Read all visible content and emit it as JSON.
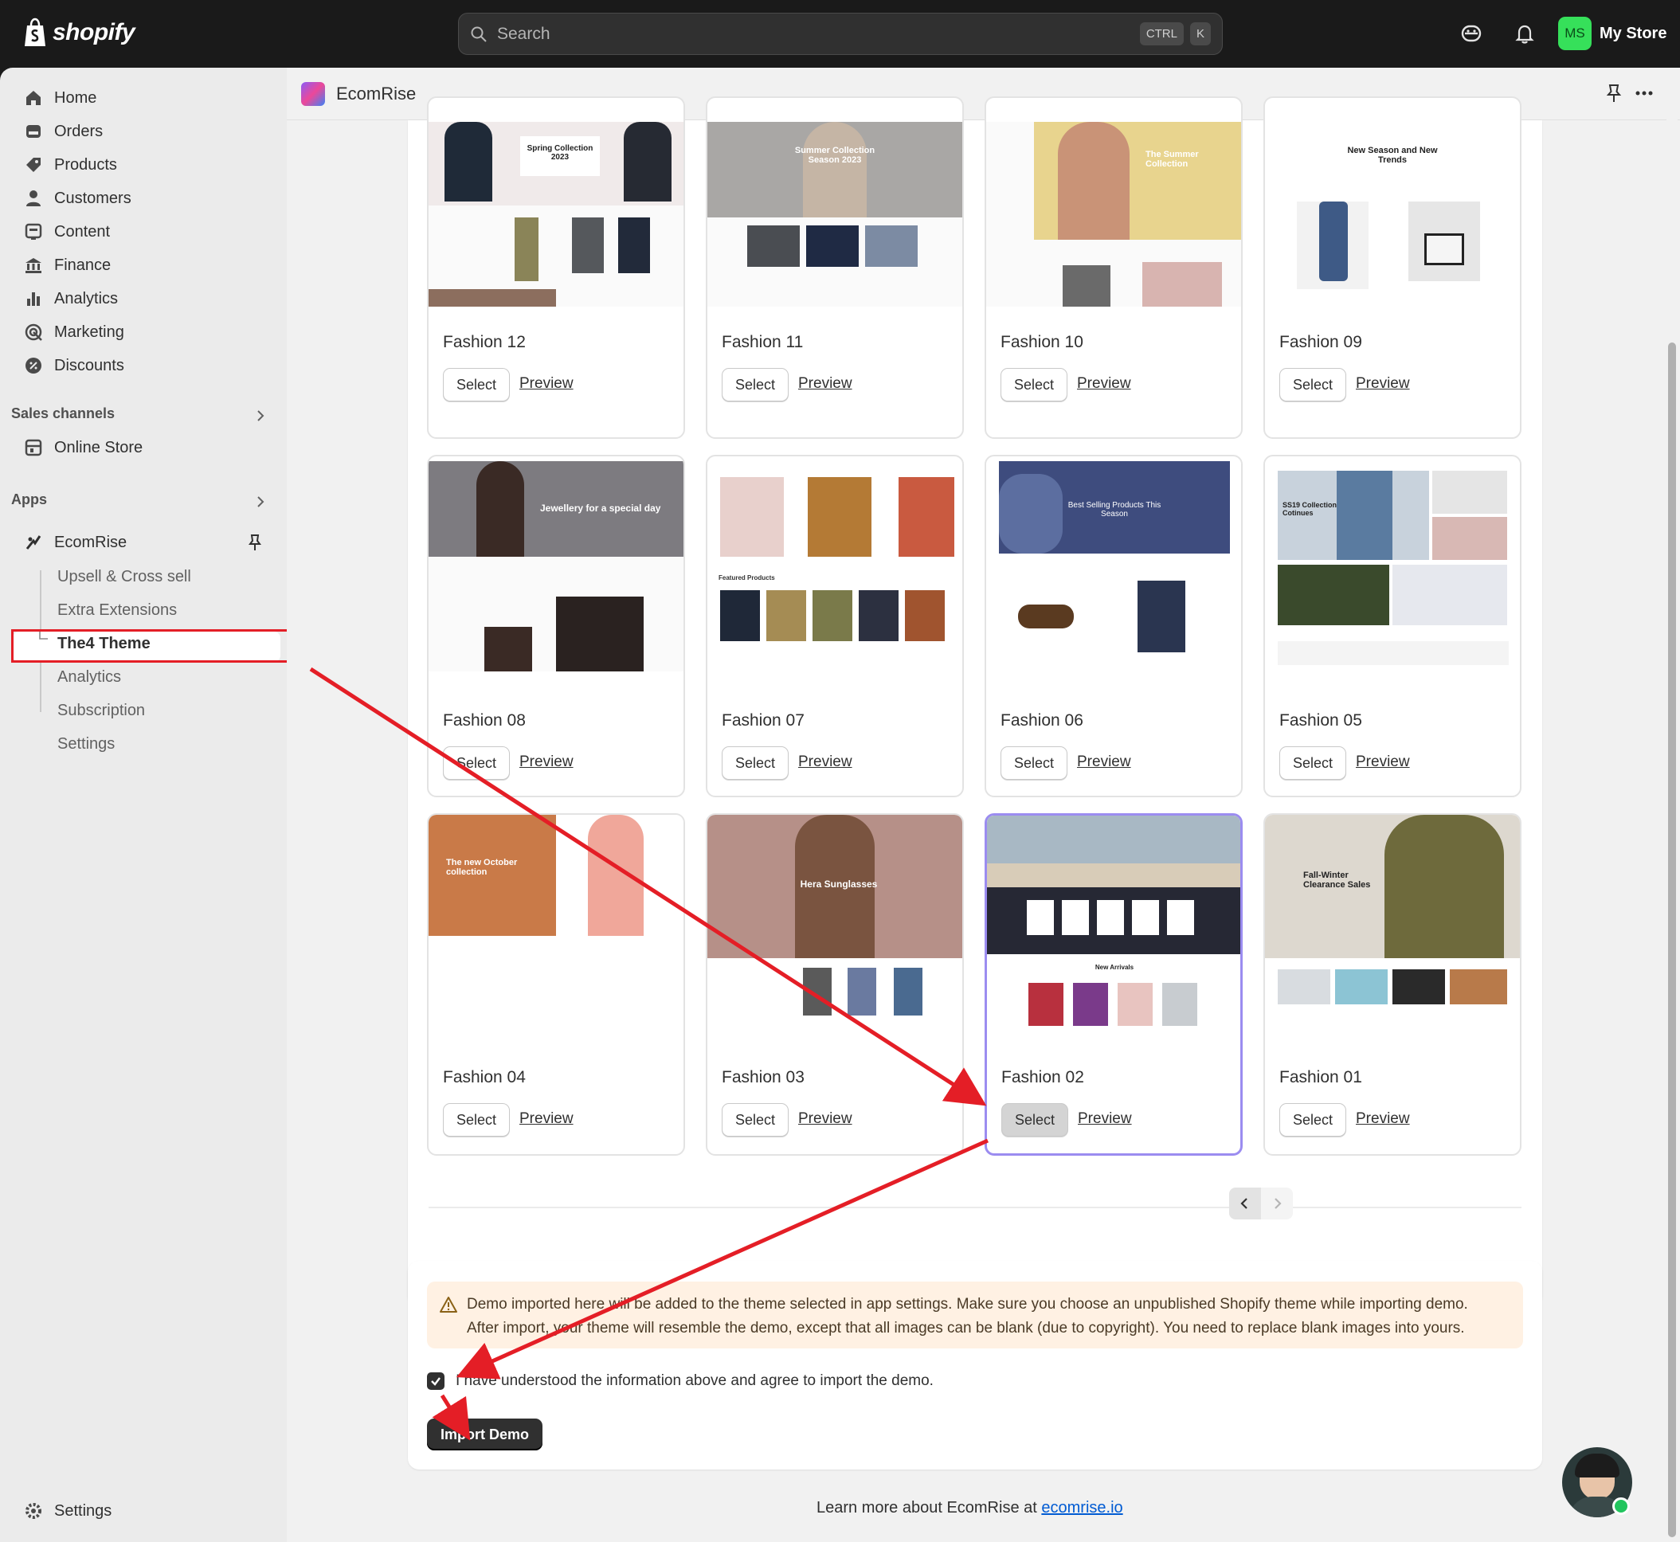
{
  "topbar": {
    "logo_text": "shopify",
    "search_placeholder": "Search",
    "kbd_ctrl": "CTRL",
    "kbd_k": "K",
    "store_initials": "MS",
    "store_name": "My Store"
  },
  "sidebar": {
    "items": [
      {
        "label": "Home",
        "icon": "home-icon"
      },
      {
        "label": "Orders",
        "icon": "orders-icon"
      },
      {
        "label": "Products",
        "icon": "tag-icon"
      },
      {
        "label": "Customers",
        "icon": "person-icon"
      },
      {
        "label": "Content",
        "icon": "content-icon"
      },
      {
        "label": "Finance",
        "icon": "bank-icon"
      },
      {
        "label": "Analytics",
        "icon": "bar-chart-icon"
      },
      {
        "label": "Marketing",
        "icon": "target-icon"
      },
      {
        "label": "Discounts",
        "icon": "discount-icon"
      }
    ],
    "sales_channels_label": "Sales channels",
    "online_store_label": "Online Store",
    "apps_label": "Apps",
    "app_name": "EcomRise",
    "app_sub_items": [
      "Upsell & Cross sell",
      "Extra Extensions",
      "The4 Theme",
      "Analytics",
      "Subscription",
      "Settings"
    ],
    "settings_label": "Settings"
  },
  "appbar": {
    "title": "EcomRise"
  },
  "themes": [
    {
      "name": "Fashion 12",
      "select": "Select",
      "preview": "Preview",
      "thumb_text": "Spring Collection 2023"
    },
    {
      "name": "Fashion 11",
      "select": "Select",
      "preview": "Preview",
      "thumb_text": "Summer Collection Season 2023"
    },
    {
      "name": "Fashion 10",
      "select": "Select",
      "preview": "Preview",
      "thumb_text": "The Summer Collection"
    },
    {
      "name": "Fashion 09",
      "select": "Select",
      "preview": "Preview",
      "thumb_text": "New Season and New Trends"
    },
    {
      "name": "Fashion 08",
      "select": "Select",
      "preview": "Preview",
      "thumb_text": "Jewellery for a special day"
    },
    {
      "name": "Fashion 07",
      "select": "Select",
      "preview": "Preview",
      "thumb_text": "Featured Products"
    },
    {
      "name": "Fashion 06",
      "select": "Select",
      "preview": "Preview",
      "thumb_text": "Best Selling Products This Season"
    },
    {
      "name": "Fashion 05",
      "select": "Select",
      "preview": "Preview",
      "thumb_text": "SS19 Collection Cotinues"
    },
    {
      "name": "Fashion 04",
      "select": "Select",
      "preview": "Preview",
      "thumb_text": "The new October collection"
    },
    {
      "name": "Fashion 03",
      "select": "Select",
      "preview": "Preview",
      "thumb_text": "Hera Sunglasses"
    },
    {
      "name": "Fashion 02",
      "select": "Select",
      "preview": "Preview",
      "thumb_text": "New Arrivals"
    },
    {
      "name": "Fashion 01",
      "select": "Select",
      "preview": "Preview",
      "thumb_text": "Fall-Winter Clearance Sales"
    }
  ],
  "import": {
    "notice_line1": "Demo imported here will be added to the theme selected in app settings. Make sure you choose an unpublished Shopify theme while importing demo.",
    "notice_line2": "After import, your theme will resemble the demo, except that all images can be blank (due to copyright). You need to replace blank images into yours.",
    "agree_text": "I have understood the information above and agree to import the demo.",
    "button_label": "Import Demo"
  },
  "footer": {
    "text": "Learn more about EcomRise at",
    "link": "ecomrise.io"
  },
  "colors": {
    "topbar_bg": "#1a1a1a",
    "accent_red": "#e41e26",
    "selected_border": "#9b8cf0",
    "store_green": "#36e05a"
  }
}
